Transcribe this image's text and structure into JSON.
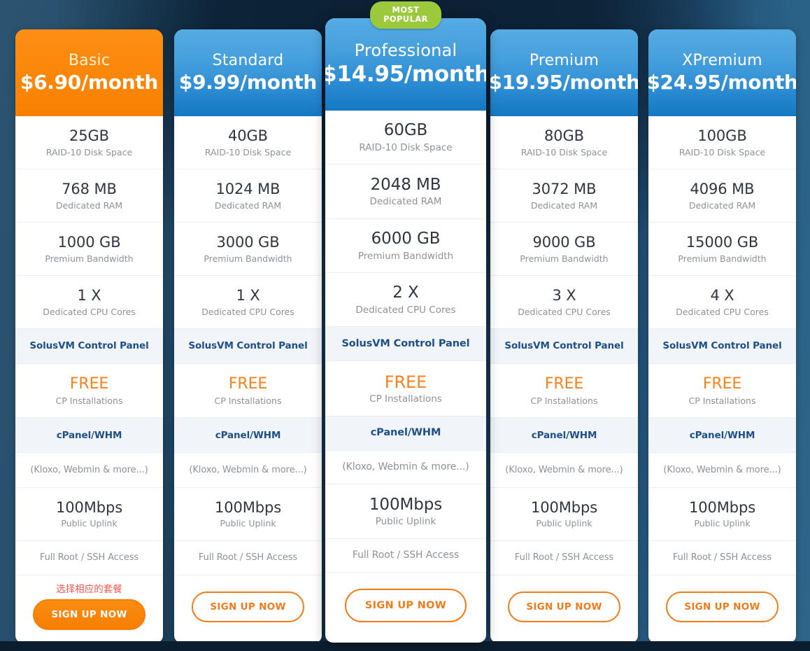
{
  "page": {
    "title": "VPS Hosting Pricing Plans",
    "badge_text": "MOST\nPOPULAR",
    "badge_color": "#9cc93c",
    "accent_orange": "#f7821b",
    "accent_blue": "#1d4f88",
    "background_dark": "#0d2438",
    "background_steel": "#2e6589"
  },
  "feature_labels": {
    "disk": "RAID-10 Disk Space",
    "ram": "Dedicated RAM",
    "bandwidth": "Premium Bandwidth",
    "cpu": "Dedicated CPU Cores",
    "control_panel": "SolusVM Control Panel",
    "cp_install_label": "CP Installations",
    "cp_install_value": "FREE",
    "cpanel": "cPanel/WHM",
    "cpanel_note": "(Kloxo, Webmin & more...)",
    "uplink": "Public Uplink",
    "root": "Full Root / SSH Access"
  },
  "plans": [
    {
      "name": "Basic",
      "price": "$6.90/month",
      "disk": "25GB",
      "ram": "768 MB",
      "bandwidth": "1000 GB",
      "cpu": "1 X",
      "uplink": "100Mbps",
      "cta_label": "SIGN UP NOW",
      "annotation": "选择相应的套餐",
      "featured": false,
      "accent": "orange",
      "cta_filled": true
    },
    {
      "name": "Standard",
      "price": "$9.99/month",
      "disk": "40GB",
      "ram": "1024 MB",
      "bandwidth": "3000 GB",
      "cpu": "1 X",
      "uplink": "100Mbps",
      "cta_label": "SIGN UP NOW",
      "annotation": "",
      "featured": false,
      "accent": "blue",
      "cta_filled": false
    },
    {
      "name": "Professional",
      "price": "$14.95/month",
      "disk": "60GB",
      "ram": "2048 MB",
      "bandwidth": "6000 GB",
      "cpu": "2 X",
      "uplink": "100Mbps",
      "cta_label": "SIGN UP NOW",
      "annotation": "",
      "featured": true,
      "accent": "blue",
      "cta_filled": false
    },
    {
      "name": "Premium",
      "price": "$19.95/month",
      "disk": "80GB",
      "ram": "3072 MB",
      "bandwidth": "9000 GB",
      "cpu": "3 X",
      "uplink": "100Mbps",
      "cta_label": "SIGN UP NOW",
      "annotation": "",
      "featured": false,
      "accent": "blue",
      "cta_filled": false
    },
    {
      "name": "XPremium",
      "price": "$24.95/month",
      "disk": "100GB",
      "ram": "4096 MB",
      "bandwidth": "15000 GB",
      "cpu": "4 X",
      "uplink": "100Mbps",
      "cta_label": "SIGN UP NOW",
      "annotation": "",
      "featured": false,
      "accent": "blue",
      "cta_filled": false
    }
  ]
}
